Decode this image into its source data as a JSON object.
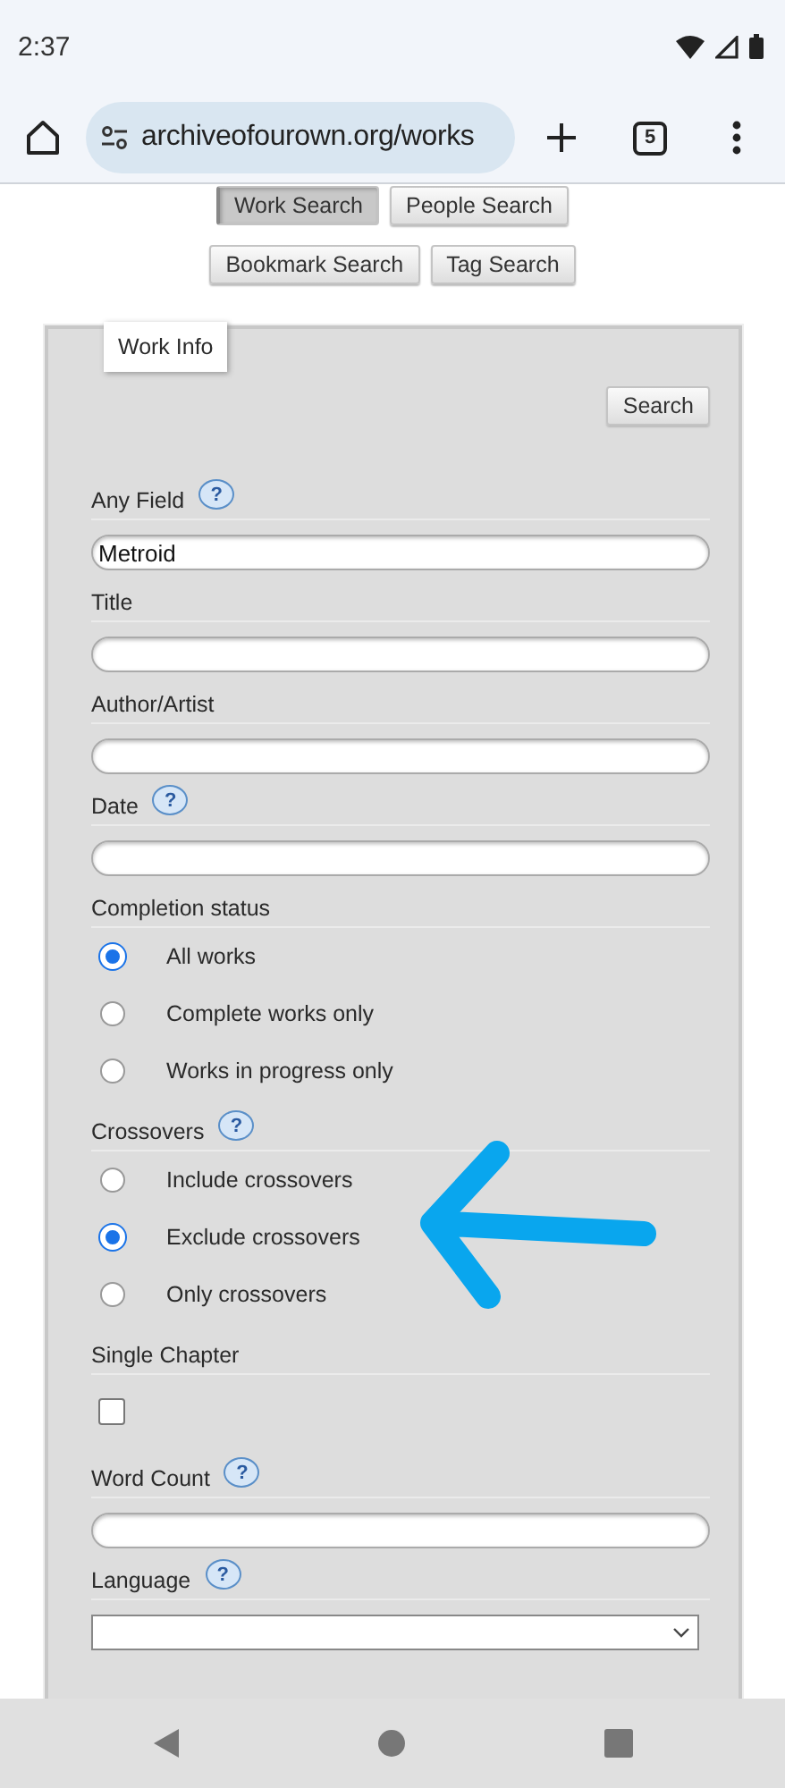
{
  "status_bar": {
    "time": "2:37"
  },
  "browser": {
    "url": "archiveofourown.org/works",
    "tab_count": "5"
  },
  "search_tabs": [
    {
      "label": "Work Search",
      "selected": true
    },
    {
      "label": "People Search",
      "selected": false
    },
    {
      "label": "Bookmark Search",
      "selected": false
    },
    {
      "label": "Tag Search",
      "selected": false
    }
  ],
  "form": {
    "legend": "Work Info",
    "submit": "Search",
    "fields": [
      {
        "kind": "text",
        "label": "Any Field",
        "help": "?",
        "value": "Metroid"
      },
      {
        "kind": "text",
        "label": "Title"
      },
      {
        "kind": "text",
        "label": "Author/Artist"
      },
      {
        "kind": "text",
        "label": "Date",
        "help": "?"
      },
      {
        "kind": "radio",
        "label": "Completion status",
        "options": [
          {
            "label": "All works",
            "selected": true
          },
          {
            "label": "Complete works only",
            "selected": false
          },
          {
            "label": "Works in progress only",
            "selected": false
          }
        ]
      },
      {
        "kind": "radio",
        "label": "Crossovers",
        "help": "?",
        "options": [
          {
            "label": "Include crossovers",
            "selected": false
          },
          {
            "label": "Exclude crossovers",
            "selected": true
          },
          {
            "label": "Only crossovers",
            "selected": false
          }
        ]
      },
      {
        "kind": "checkbox",
        "label": "Single Chapter",
        "checked": false
      },
      {
        "kind": "text",
        "label": "Word Count",
        "help": "?"
      },
      {
        "kind": "select",
        "label": "Language",
        "help": "?"
      }
    ]
  }
}
